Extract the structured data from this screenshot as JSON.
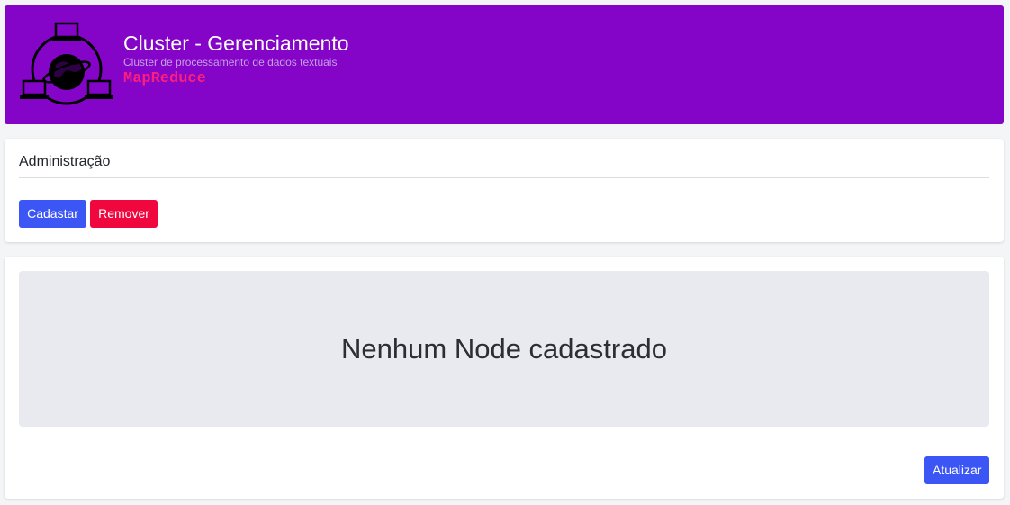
{
  "header": {
    "title": "Cluster - Gerenciamento",
    "subtitle": "Cluster de processamento de dados textuais",
    "badge": "MapReduce",
    "logo_icon": "network-globe-icon",
    "colors": {
      "background": "#8404c8",
      "badge": "#ff1f7a"
    }
  },
  "admin": {
    "title": "Administração",
    "cadastrar_label": "Cadastar",
    "remover_label": "Remover"
  },
  "nodes": {
    "empty_message": "Nenhum Node cadastrado",
    "atualizar_label": "Atualizar"
  },
  "colors": {
    "primary": "#3b56f5",
    "danger": "#f0073e"
  }
}
